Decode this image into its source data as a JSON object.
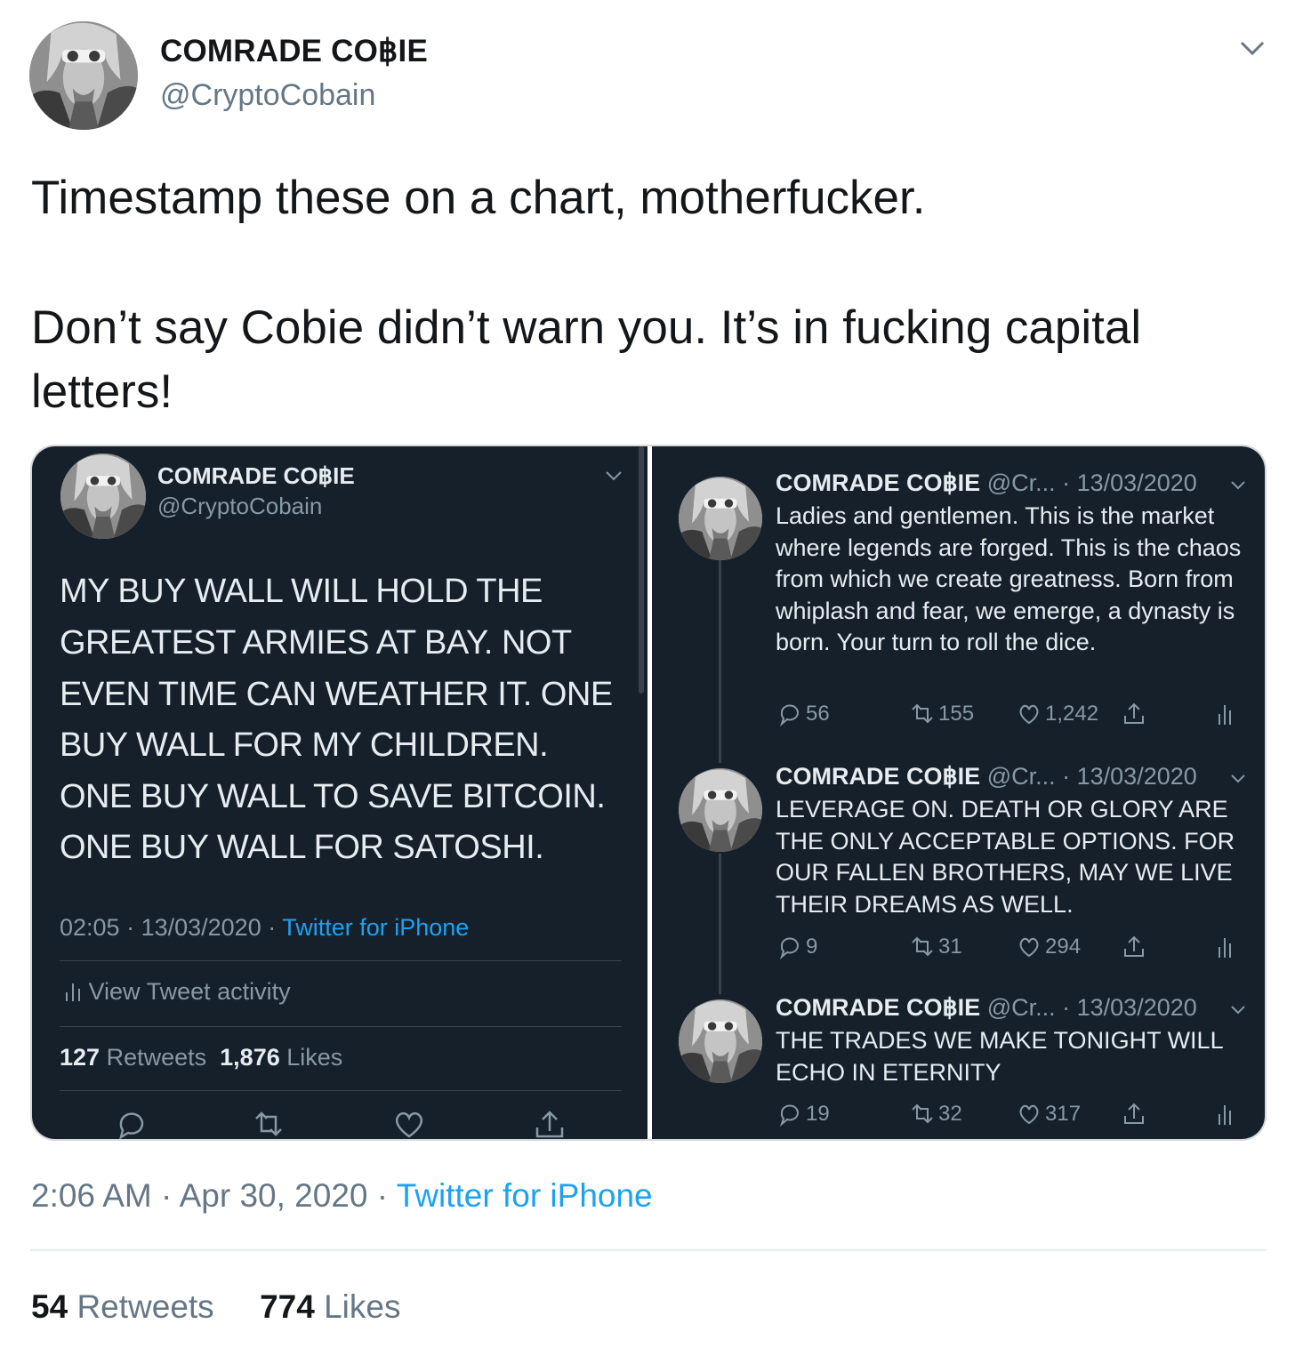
{
  "tweet": {
    "author_name": "COMRADE CO฿IE",
    "author_handle": "@CryptoCobain",
    "text_line1": "Timestamp these on a chart, motherfucker.",
    "text_para2": "Don’t say Cobie didn’t warn you. It’s in fucking capital letters!",
    "time": "2:06 AM",
    "date": "Apr 30, 2020",
    "source": "Twitter for iPhone",
    "retweets": "54",
    "retweets_label": "Retweets",
    "likes": "774",
    "likes_label": "Likes"
  },
  "left_shot": {
    "name": "COMRADE CO฿IE",
    "handle": "@CryptoCobain",
    "lines": [
      "MY BUY WALL WILL HOLD THE",
      "GREATEST ARMIES AT BAY. NOT",
      "EVEN TIME CAN WEATHER IT. ONE",
      "BUY WALL FOR MY CHILDREN.",
      "ONE BUY WALL TO SAVE BITCOIN.",
      "ONE BUY WALL FOR SATOSHI."
    ],
    "time": "02:05",
    "date": "13/03/2020",
    "source": "Twitter for iPhone",
    "activity": "View Tweet activity",
    "retweets": "127",
    "retweets_label": "Retweets",
    "likes": "1,876",
    "likes_label": "Likes"
  },
  "right_shot": {
    "tweets": [
      {
        "name": "COMRADE CO฿IE",
        "handle": "@Cr...",
        "date": "13/03/2020",
        "text": "Ladies and gentlemen. This is the market where legends are forged. This is the chaos from which we create greatness. Born from whiplash and fear, we emerge, a dynasty is born. Your turn to roll the dice.",
        "replies": "56",
        "retweets": "155",
        "likes": "1,242"
      },
      {
        "name": "COMRADE CO฿IE",
        "handle": "@Cr...",
        "date": "13/03/2020",
        "text": "LEVERAGE ON. DEATH OR GLORY ARE THE ONLY ACCEPTABLE OPTIONS. FOR OUR FALLEN BROTHERS, MAY WE LIVE THEIR DREAMS AS WELL.",
        "replies": "9",
        "retweets": "31",
        "likes": "294"
      },
      {
        "name": "COMRADE CO฿IE",
        "handle": "@Cr...",
        "date": "13/03/2020",
        "text": "THE TRADES WE MAKE TONIGHT WILL ECHO IN ETERNITY",
        "replies": "19",
        "retweets": "32",
        "likes": "317"
      }
    ]
  },
  "icons": {
    "reply": "speech-bubble-icon",
    "retweet": "retweet-arrows-icon",
    "like": "heart-outline-icon",
    "share": "share-upload-icon",
    "analytics": "bar-chart-icon",
    "caret": "chevron-down-icon"
  },
  "colors": {
    "link": "#1da1f2",
    "dark_bg": "#15202b",
    "secondary_text": "#657786"
  }
}
